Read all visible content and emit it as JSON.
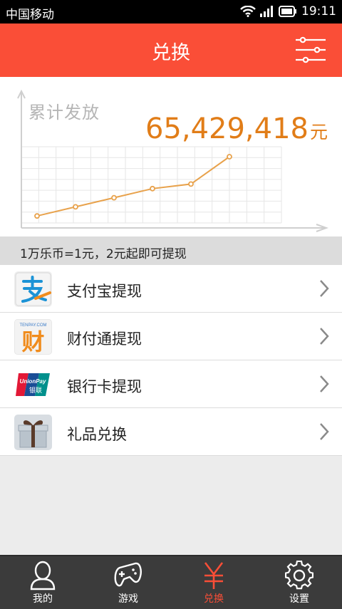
{
  "status_bar": {
    "carrier": "中国移动",
    "time": "19:11"
  },
  "header": {
    "title": "兑换",
    "menu_icon": "settings-sliders-icon"
  },
  "stats": {
    "label": "累计发放",
    "amount": "65,429,418",
    "unit": "元",
    "accent_color": "#e17d18"
  },
  "chart_data": {
    "type": "line",
    "title": "",
    "xlabel": "",
    "ylabel": "",
    "points_count": 6,
    "values": [
      1,
      2,
      3,
      4,
      4.5,
      7.5
    ],
    "ylim": [
      0,
      10
    ],
    "grid": true
  },
  "notice": "1万乐币=1元，2元起即可提现",
  "options": [
    {
      "label": "支付宝提现",
      "icon": "alipay-icon"
    },
    {
      "label": "财付通提现",
      "icon": "tenpay-icon",
      "icon_text": "TENPAY.COM",
      "icon_char": "财"
    },
    {
      "label": "银行卡提现",
      "icon": "unionpay-icon",
      "icon_text": "UnionPay",
      "icon_cn": "银联"
    },
    {
      "label": "礼品兑换",
      "icon": "gift-icon"
    }
  ],
  "tabs": [
    {
      "label": "我的",
      "icon": "person-icon"
    },
    {
      "label": "游戏",
      "icon": "gamepad-icon"
    },
    {
      "label": "兑换",
      "icon": "yen-icon",
      "active": true
    },
    {
      "label": "设置",
      "icon": "gear-icon"
    }
  ],
  "colors": {
    "brand": "#fa4e37",
    "tab_bar": "#3b3b3b"
  }
}
